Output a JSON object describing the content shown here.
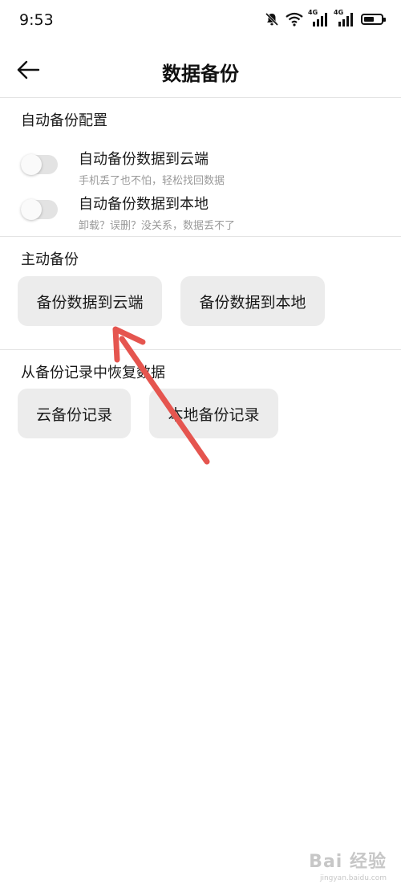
{
  "status_bar": {
    "time": "9:53",
    "network1": "4G",
    "network2": "4G",
    "icons": [
      "mute-icon",
      "wifi-icon",
      "signal-icon",
      "signal-icon",
      "battery-icon"
    ],
    "battery_level": 0.6
  },
  "header": {
    "title": "数据备份",
    "back_icon": "arrow-left-icon"
  },
  "auto_backup": {
    "section_title": "自动备份配置",
    "items": [
      {
        "title": "自动备份数据到云端",
        "subtitle": "手机丢了也不怕，轻松找回数据",
        "enabled": false
      },
      {
        "title": "自动备份数据到本地",
        "subtitle": "卸载？误删？没关系，数据丢不了",
        "enabled": false
      }
    ]
  },
  "manual_backup": {
    "section_title": "主动备份",
    "buttons": [
      "备份数据到云端",
      "备份数据到本地"
    ]
  },
  "restore": {
    "section_title": "从备份记录中恢复数据",
    "buttons": [
      "云备份记录",
      "本地备份记录"
    ]
  },
  "annotation": {
    "arrow_color": "#e5554f"
  },
  "watermark": {
    "main": "Bai 经验",
    "sub": "jingyan.baidu.com"
  }
}
